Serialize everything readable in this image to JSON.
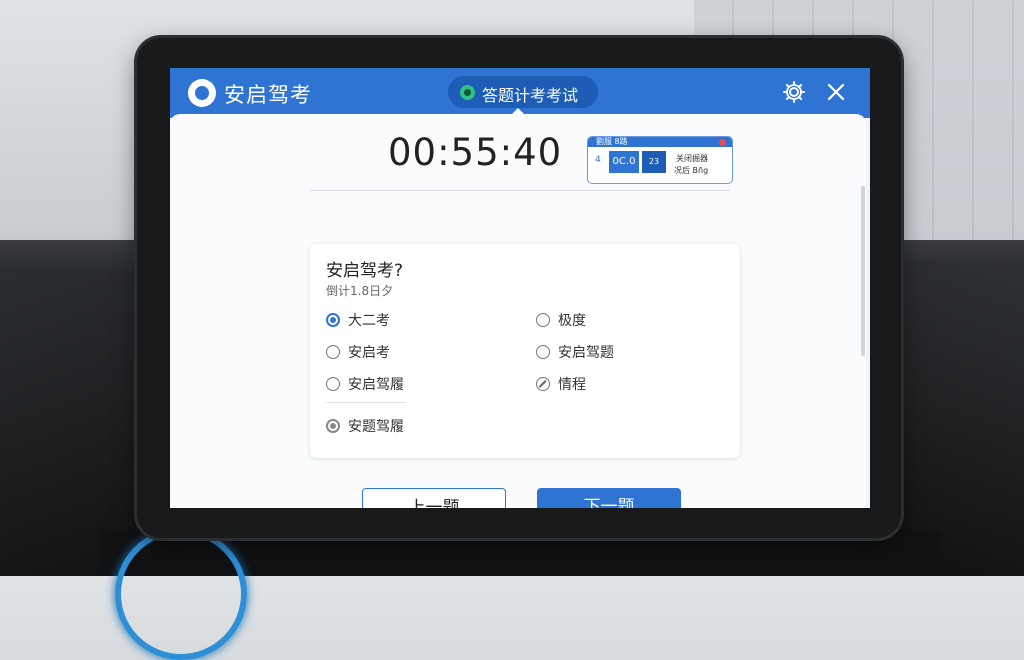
{
  "window": {
    "app_title": "安启驾考",
    "mode_label": "答题计考考试"
  },
  "timer": {
    "value": "00:55:40"
  },
  "mini_panel": {
    "header": "劉服 8路",
    "left_num": "4",
    "box1": "0C.0",
    "box2": "23",
    "line1": "关闭掘器",
    "line2": "况后 Bñg"
  },
  "question": {
    "title": "安启驾考?",
    "subtitle": "倒计1.8日夕",
    "options": [
      {
        "label": "大二考",
        "state": "selected"
      },
      {
        "label": "极度",
        "state": "empty"
      },
      {
        "label": "安启考",
        "state": "empty"
      },
      {
        "label": "安启驾题",
        "state": "empty"
      },
      {
        "label": "安启驾履",
        "state": "empty"
      },
      {
        "label": "情程",
        "state": "slashed"
      },
      {
        "label": "安题驾履",
        "state": "gray"
      }
    ]
  },
  "buttons": {
    "prev": "上一题",
    "next": "下一题"
  },
  "colors": {
    "primary": "#2f74d3",
    "primary_dark": "#1d5db5",
    "accent_green": "#2fc282"
  }
}
